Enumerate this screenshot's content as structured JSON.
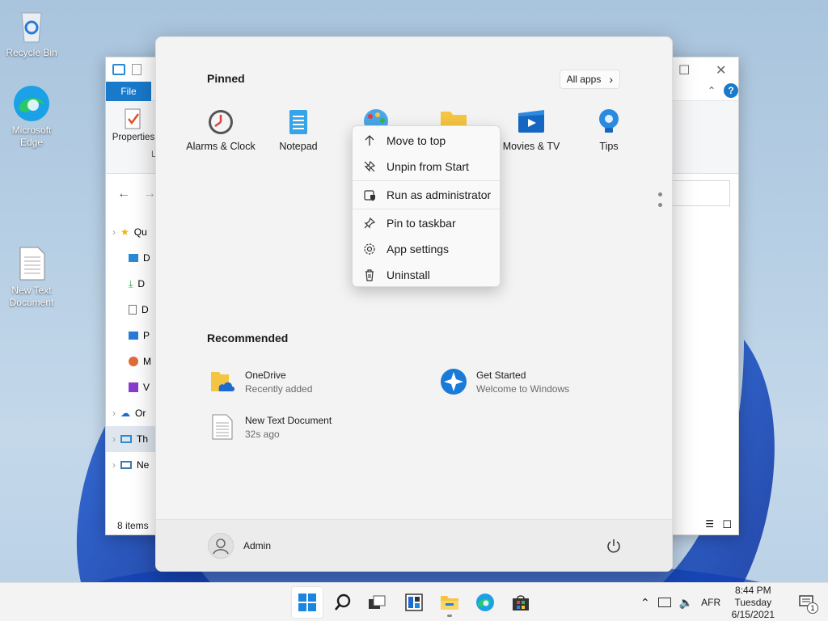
{
  "desktop": {
    "icons": [
      {
        "label": "Recycle Bin",
        "icon": "recycle-bin-icon"
      },
      {
        "label": "Microsoft Edge",
        "icon": "edge-icon"
      },
      {
        "label": "New Text Document",
        "icon": "text-document-icon"
      }
    ]
  },
  "explorer": {
    "file_tab": "File",
    "properties_label": "Properties",
    "ribbon_group_fragment": "L",
    "status": "8 items",
    "sidebar": [
      {
        "text": "Qu"
      },
      {
        "text": "D"
      },
      {
        "text": "D"
      },
      {
        "text": "D"
      },
      {
        "text": "P"
      },
      {
        "text": "M"
      },
      {
        "text": "V"
      },
      {
        "text": "Or"
      },
      {
        "text": "Th"
      },
      {
        "text": "Ne"
      }
    ]
  },
  "start_menu": {
    "pinned_title": "Pinned",
    "all_apps_label": "All apps",
    "pinned_apps": [
      {
        "label": "Alarms & Clock",
        "icon": "alarm-clock-icon"
      },
      {
        "label": "Notepad",
        "icon": "notepad-icon"
      },
      {
        "label": "",
        "icon": "paint-icon"
      },
      {
        "label": "",
        "icon": "folder-icon"
      },
      {
        "label": "Movies & TV",
        "icon": "movies-tv-icon"
      },
      {
        "label": "Tips",
        "icon": "tips-icon"
      }
    ],
    "recommended_title": "Recommended",
    "recommended": [
      {
        "title": "OneDrive",
        "subtitle": "Recently added",
        "icon": "onedrive-folder-icon"
      },
      {
        "title": "Get Started",
        "subtitle": "Welcome to Windows",
        "icon": "get-started-icon"
      },
      {
        "title": "New Text Document",
        "subtitle": "32s ago",
        "icon": "text-document-icon"
      }
    ],
    "user_name": "Admin"
  },
  "context_menu": {
    "items": [
      {
        "label": "Move to top",
        "icon": "arrow-up-icon"
      },
      {
        "label": "Unpin from Start",
        "icon": "unpin-icon"
      },
      {
        "label": "Run as administrator",
        "icon": "shield-admin-icon"
      },
      {
        "label": "Pin to taskbar",
        "icon": "pin-icon"
      },
      {
        "label": "App settings",
        "icon": "gear-icon"
      },
      {
        "label": "Uninstall",
        "icon": "trash-icon"
      }
    ]
  },
  "taskbar": {
    "apps": [
      "start-icon",
      "search-icon",
      "task-view-icon",
      "widgets-icon",
      "file-explorer-icon",
      "edge-icon",
      "store-icon"
    ],
    "language": "AFR",
    "time": "8:44 PM",
    "day": "Tuesday",
    "date": "6/15/2021",
    "notification_count": "1"
  },
  "colors": {
    "accent": "#1979ca",
    "start_bg": "#f3f3f3",
    "taskbar_bg": "#f3f3f3"
  }
}
